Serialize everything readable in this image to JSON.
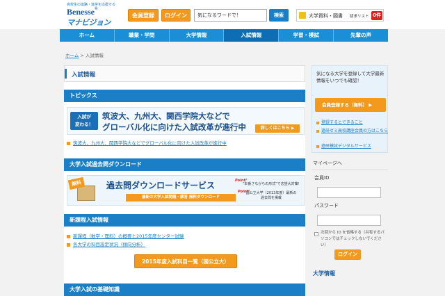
{
  "header": {
    "tagline": "高校生の進路・進学を応援する",
    "brand_top": "Benesse",
    "brand_reg": "®",
    "brand_main": "マナビジョン",
    "register_button": "会員登録",
    "login_button": "ログイン",
    "search_value": "気になるワードで！",
    "search_button": "検索",
    "cart_label": "大学資料・願書",
    "cart_list_label": "請求リスト",
    "cart_count": "0",
    "cart_count_suffix": "件"
  },
  "nav": {
    "items": [
      {
        "label": "ホーム"
      },
      {
        "label": "職業・学問"
      },
      {
        "label": "大学情報"
      },
      {
        "label": "入試情報"
      },
      {
        "label": "学習・模試"
      },
      {
        "label": "先輩の声"
      }
    ],
    "active_index": 3
  },
  "breadcrumb": {
    "home": "ホーム",
    "separator": " > ",
    "current": "入試情報"
  },
  "main": {
    "page_title": "入試情報",
    "topics": {
      "heading": "トピックス",
      "badge_line1": "入試が",
      "badge_line2": "変わる！",
      "banner_line1": "筑波大、九州大、関西学院大などで",
      "banner_line2": "グローバル化に向けた入試改革が進行中",
      "more_button": "詳しくはこちら ▶",
      "link": "筑波大、九州大、関西学院大などでグローバル化に向けた入試改革が進行中"
    },
    "kakomon": {
      "heading": "大学入試過去問ダウンロード",
      "free_badge": "無料",
      "title": "過去問ダウンロードサービス",
      "subtitle": "最新の大学入試問題・解答 無料ダウンロード",
      "point_label": "Point!",
      "note1": "\"本番さながらの形式\"で志望大対策!",
      "note2": "国公立大学（2013年度）最新の過去問を掲載"
    },
    "curriculum": {
      "heading": "新課程入試情報",
      "links": [
        "新課程（数学・理科）の概要と2015年度センター試験",
        "各大学の科目設定状況（傾向分析）"
      ],
      "list_button": "2015年度入試科目一覧（国公立大）"
    },
    "basics": {
      "heading": "大学入試の基礎知識"
    }
  },
  "sidebar": {
    "intro": "気になる大学を登録して大学最新情報をいつでも確認！",
    "register_button": "会員登録する（無料） ▶",
    "links": [
      "登録するとできること",
      "進研ゼミ高校講座会員の方はこちら",
      "進研模試デジタルサービス"
    ],
    "mypage_label": "マイページへ",
    "id_label": "会員ID",
    "password_label": "パスワード",
    "keep_login_text": "次回から ID を省略する（共有するパソコンではチェックしないでください）",
    "login_button": "ログイン",
    "university_heading": "大学情報"
  },
  "colors": {
    "accent_blue": "#1a7fc7",
    "nav_blue": "#1a8fd6",
    "orange": "#f39a1e",
    "badge_red": "#e02020"
  }
}
